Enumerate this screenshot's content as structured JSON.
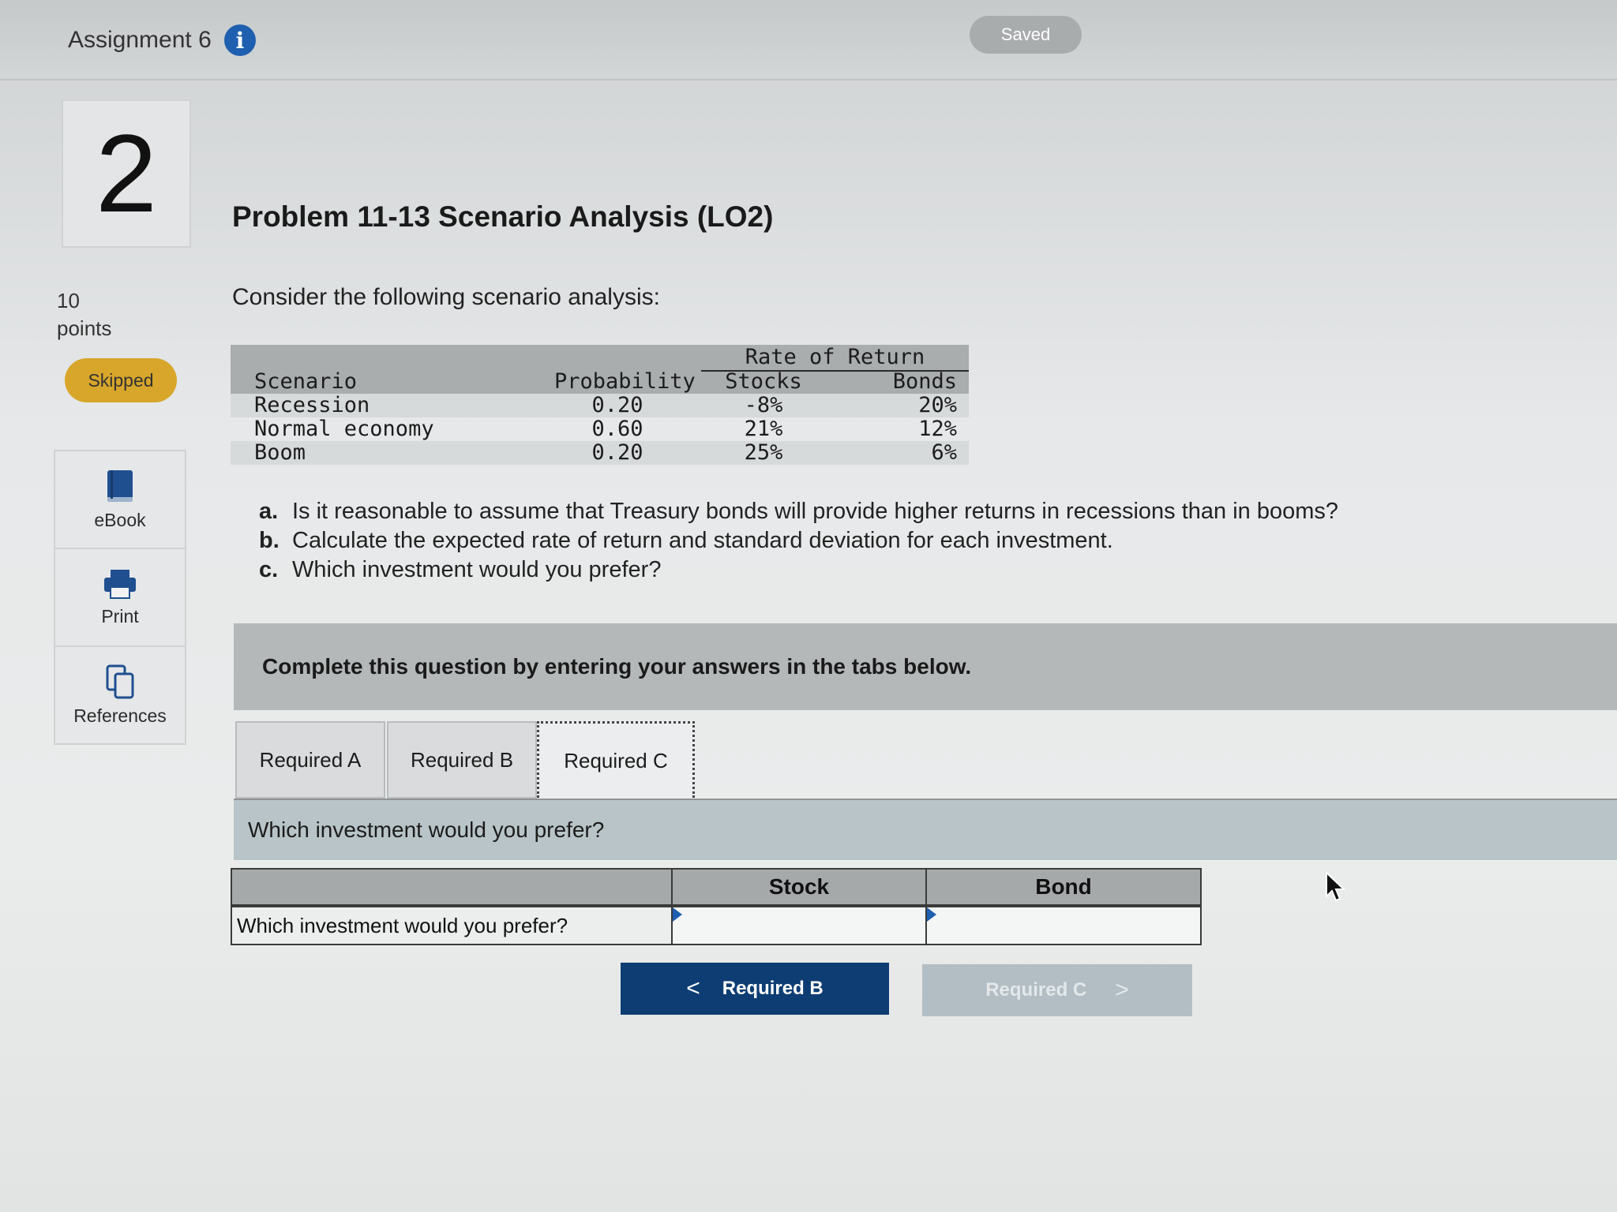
{
  "header": {
    "assignment_title": "Assignment 6",
    "info_icon_glyph": "i",
    "saved_label": "Saved"
  },
  "sidebar": {
    "question_number": "2",
    "points_value": "10",
    "points_label": "points",
    "status_label": "Skipped",
    "tools": [
      {
        "label": "eBook",
        "icon": "book-icon"
      },
      {
        "label": "Print",
        "icon": "printer-icon"
      },
      {
        "label": "References",
        "icon": "copy-pages-icon"
      }
    ]
  },
  "problem": {
    "title": "Problem 11-13 Scenario Analysis (LO2)",
    "intro": "Consider the following scenario analysis:",
    "table": {
      "group_header": "Rate of Return",
      "columns": [
        "Scenario",
        "Probability",
        "Stocks",
        "Bonds"
      ],
      "rows": [
        {
          "scenario": "Recession",
          "probability": "0.20",
          "stocks": "-8%",
          "bonds": "20%"
        },
        {
          "scenario": "Normal economy",
          "probability": "0.60",
          "stocks": "21%",
          "bonds": "12%"
        },
        {
          "scenario": "Boom",
          "probability": "0.20",
          "stocks": "25%",
          "bonds": "6%"
        }
      ]
    },
    "questions": [
      {
        "marker": "a.",
        "text": "Is it reasonable to assume that Treasury bonds will provide higher returns in recessions than in booms?"
      },
      {
        "marker": "b.",
        "text": "Calculate the expected rate of return and standard deviation for each investment."
      },
      {
        "marker": "c.",
        "text": "Which investment would you prefer?"
      }
    ]
  },
  "instructions_banner": "Complete this question by entering your answers in the tabs below.",
  "tabs": [
    {
      "label": "Required A",
      "active": false
    },
    {
      "label": "Required B",
      "active": false
    },
    {
      "label": "Required C",
      "active": true
    }
  ],
  "required_c": {
    "prompt": "Which investment would you prefer?",
    "answer_table": {
      "headers": [
        "Stock",
        "Bond"
      ],
      "row_label": "Which investment would you prefer?",
      "stock_value": "",
      "bond_value": ""
    }
  },
  "navigation": {
    "prev_label": "Required B",
    "next_label": "Required C",
    "prev_chevron": "<",
    "next_chevron": ">"
  },
  "colors": {
    "info_blue": "#1f5fb0",
    "skipped_gold": "#d8a62a",
    "nav_primary": "#0e3d73",
    "nav_disabled": "#b3bec4"
  }
}
